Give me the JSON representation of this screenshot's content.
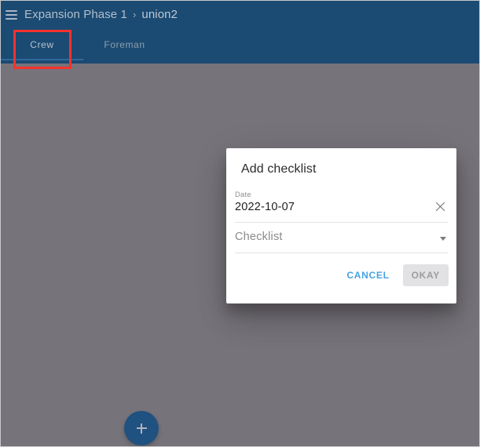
{
  "header": {
    "menu_icon": "hamburger-menu-icon",
    "breadcrumb": {
      "root": "Expansion Phase 1",
      "separator": "›",
      "current": "union2"
    },
    "background_color": "#1b4a72"
  },
  "tabs": [
    {
      "label": "Crew",
      "active": true
    },
    {
      "label": "Foreman",
      "active": false
    }
  ],
  "fab": {
    "icon": "plus-icon",
    "color": "#1f5181"
  },
  "dialog": {
    "title": "Add checklist",
    "date_field": {
      "label": "Date",
      "value": "2022-10-07",
      "clear_icon": "close-icon"
    },
    "checklist_field": {
      "placeholder": "Checklist",
      "value": "",
      "dropdown_icon": "chevron-down-icon"
    },
    "actions": {
      "cancel": "CANCEL",
      "okay": "OKAY",
      "cancel_color": "#47a3e3",
      "okay_disabled": true
    }
  },
  "annotation": {
    "target": "Crew",
    "color": "#f8322d"
  },
  "page": {
    "scrim_color": "#77737a"
  }
}
